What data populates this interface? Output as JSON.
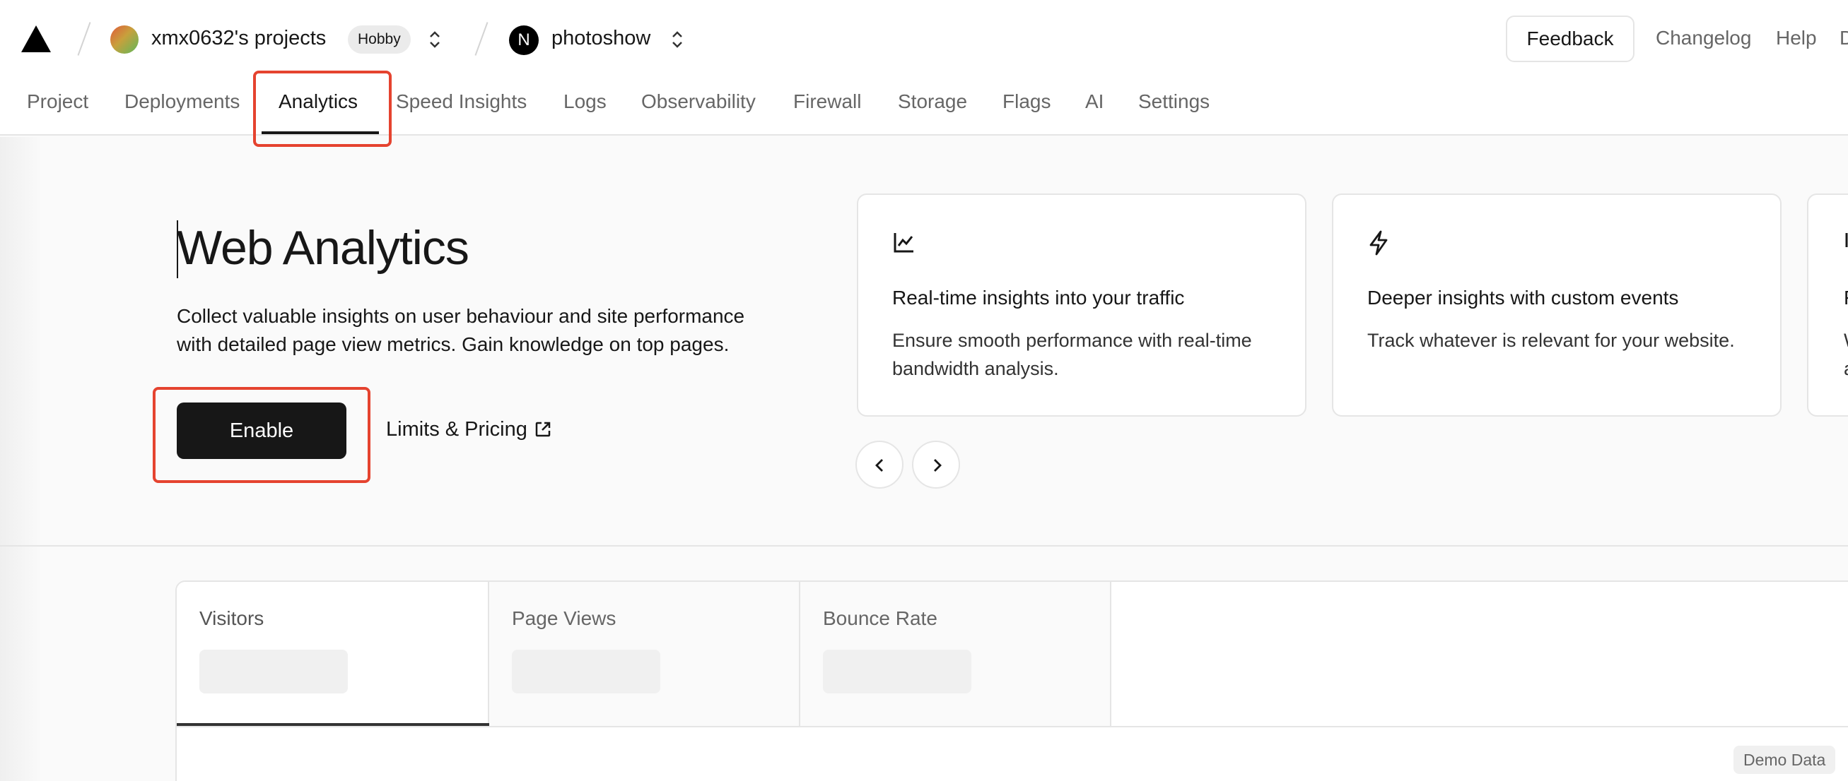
{
  "header": {
    "team_name": "xmx0632's projects",
    "plan_badge": "Hobby",
    "project_initial": "N",
    "project_name": "photoshow",
    "feedback_label": "Feedback",
    "changelog_label": "Changelog",
    "help_label": "Help",
    "cut_off_link": "D"
  },
  "tabs": [
    {
      "label": "Project"
    },
    {
      "label": "Deployments"
    },
    {
      "label": "Analytics",
      "active": true
    },
    {
      "label": "Speed Insights"
    },
    {
      "label": "Logs"
    },
    {
      "label": "Observability"
    },
    {
      "label": "Firewall"
    },
    {
      "label": "Storage"
    },
    {
      "label": "Flags"
    },
    {
      "label": "AI"
    },
    {
      "label": "Settings"
    }
  ],
  "hero": {
    "title": "Web Analytics",
    "description": "Collect valuable insights on user behaviour and site performance with detailed page view metrics. Gain knowledge on top pages.",
    "enable_label": "Enable",
    "limits_label": "Limits & Pricing"
  },
  "cards": [
    {
      "icon": "line-chart-icon",
      "title": "Real-time insights into your traffic",
      "description": "Ensure smooth performance with real-time bandwidth analysis."
    },
    {
      "icon": "lightning-icon",
      "title": "Deeper insights with custom events",
      "description": "Track whatever is relevant for your website."
    },
    {
      "icon": "partial-icon",
      "title": "F",
      "description": "W a"
    }
  ],
  "metrics": [
    {
      "label": "Visitors",
      "active": true
    },
    {
      "label": "Page Views"
    },
    {
      "label": "Bounce Rate"
    }
  ],
  "demo_badge": "Demo Data",
  "colors": {
    "accent": "#171717",
    "highlight": "#e5432f",
    "muted_text": "#666666",
    "border": "#e5e5e5"
  }
}
